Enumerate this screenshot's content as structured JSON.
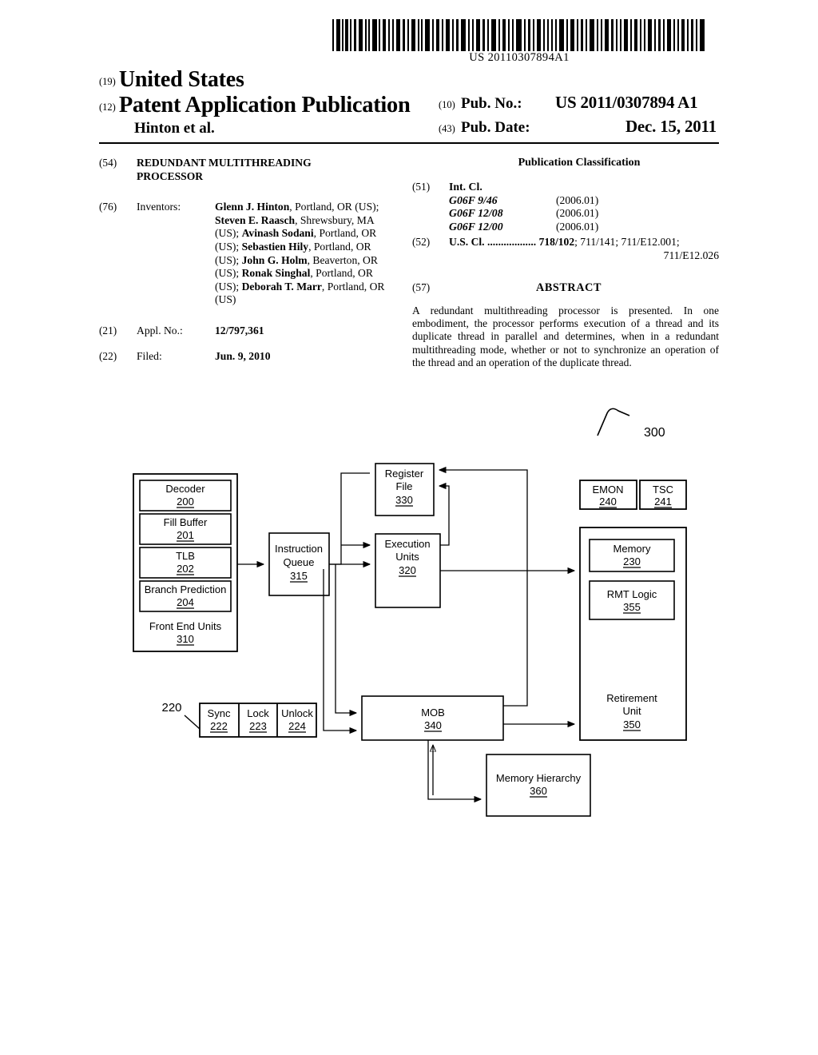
{
  "barcode": {
    "number": "US 20110307894A1"
  },
  "masthead": {
    "tag_19": "(19)",
    "country": "United States",
    "tag_12": "(12)",
    "doc_type": "Patent Application Publication",
    "author_line": "Hinton et al.",
    "pub_no_tag": "(10)",
    "pub_no_label": "Pub. No.:",
    "pub_no_value": "US 2011/0307894 A1",
    "pub_date_tag": "(43)",
    "pub_date_label": "Pub. Date:",
    "pub_date_value": "Dec. 15, 2011"
  },
  "biblio": {
    "title_tag": "(54)",
    "title_line1": "REDUNDANT MULTITHREADING",
    "title_line2": "PROCESSOR",
    "inventors_tag": "(76)",
    "inventors_label": "Inventors:",
    "inventors_html": "<span class=\"b\">Glenn J. Hinton</span>, Portland, OR (US); <span class=\"b\">Steven E. Raasch</span>, Shrewsbury, MA (US); <span class=\"b\">Avinash Sodani</span>, Portland, OR (US); <span class=\"b\">Sebastien Hily</span>, Portland, OR (US); <span class=\"b\">John G. Holm</span>, Beaverton, OR (US); <span class=\"b\">Ronak Singhal</span>, Portland, OR (US); <span class=\"b\">Deborah T. Marr</span>, Portland, OR (US)",
    "appl_tag": "(21)",
    "appl_label": "Appl. No.:",
    "appl_value": "12/797,361",
    "filed_tag": "(22)",
    "filed_label": "Filed:",
    "filed_value": "Jun. 9, 2010"
  },
  "classification": {
    "heading": "Publication Classification",
    "int_cl_tag": "(51)",
    "int_cl_label": "Int. Cl.",
    "int_cl_entries": [
      {
        "code": "G06F  9/46",
        "version": "(2006.01)"
      },
      {
        "code": "G06F  12/08",
        "version": "(2006.01)"
      },
      {
        "code": "G06F  12/00",
        "version": "(2006.01)"
      }
    ],
    "us_cl_tag": "(52)",
    "us_cl_label": "U.S. Cl.",
    "us_cl_dots": " ..................",
    "us_cl_primary": "718/102",
    "us_cl_rest": "; 711/141; 711/E12.001;",
    "us_cl_line2": "711/E12.026"
  },
  "abstract": {
    "tag": "(57)",
    "heading": "ABSTRACT",
    "text": "A redundant multithreading processor is presented. In one embodiment, the processor performs execution of a thread and its duplicate thread in parallel and determines, when in a redundant multithreading mode, whether or not to synchro­nize an operation of the thread and an operation of the dupli­cate thread."
  },
  "figure": {
    "figure_ref": "300",
    "group_ref_220": "220",
    "blocks": {
      "decoder": {
        "label": "Decoder",
        "ref": "200"
      },
      "fill_buffer": {
        "label": "Fill Buffer",
        "ref": "201"
      },
      "tlb": {
        "label": "TLB",
        "ref": "202"
      },
      "branch_prediction": {
        "label": "Branch Prediction",
        "ref": "204"
      },
      "front_end_units": {
        "label": "Front End Units",
        "ref": "310"
      },
      "instruction_queue": {
        "label_line1": "Instruction",
        "label_line2": "Queue",
        "ref": "315"
      },
      "register_file": {
        "label_line1": "Register",
        "label_line2": "File",
        "ref": "330"
      },
      "execution_units": {
        "label_line1": "Execution",
        "label_line2": "Units",
        "ref": "320"
      },
      "emon": {
        "label": "EMON",
        "ref": "240"
      },
      "tsc": {
        "label": "TSC",
        "ref": "241"
      },
      "memory": {
        "label": "Memory",
        "ref": "230"
      },
      "rmt_logic": {
        "label": "RMT Logic",
        "ref": "355"
      },
      "retirement_unit": {
        "label_line1": "Retirement",
        "label_line2": "Unit",
        "ref": "350"
      },
      "sync": {
        "label": "Sync",
        "ref": "222"
      },
      "lock": {
        "label": "Lock",
        "ref": "223"
      },
      "unlock": {
        "label": "Unlock",
        "ref": "224"
      },
      "mob": {
        "label": "MOB",
        "ref": "340"
      },
      "memory_hierarchy": {
        "label": "Memory Hierarchy",
        "ref": "360"
      }
    }
  }
}
